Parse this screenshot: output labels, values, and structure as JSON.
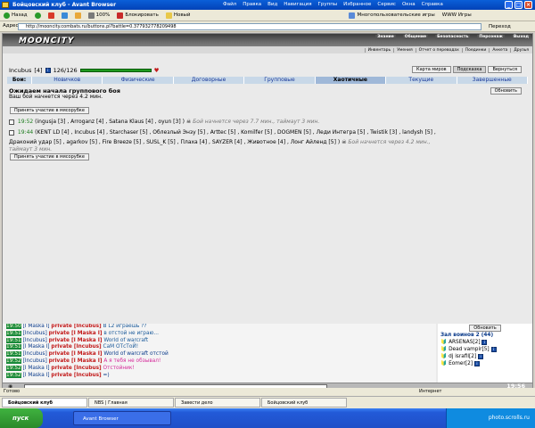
{
  "window": {
    "title": "Бойцовский клуб - Avant Browser"
  },
  "menu": [
    "Файл",
    "Правка",
    "Вид",
    "Навигация",
    "Группы",
    "Избранное",
    "Сервис",
    "Окна",
    "Справка"
  ],
  "toolbar": {
    "back": "Назад",
    "zoom": "100%",
    "block": "Блокировать",
    "new": "Новый",
    "multiuser": "Многопользовательские игры",
    "www": "WWW Игры"
  },
  "address": {
    "label": "Адрес",
    "url": "http://mooncity.combats.ru/buttons.pl?battle=0.377932778209498",
    "go": "Переход"
  },
  "site": {
    "logo": "MOONCITY",
    "topnav": [
      "Знание",
      "Общение",
      "Безопасность",
      "Персонаж",
      "Выход"
    ],
    "subnav": [
      "Инвентарь",
      "Умения",
      "Отчет о переводах",
      "Поединки",
      "Анкета",
      "Друзья"
    ]
  },
  "player": {
    "name": "Incubus",
    "level": "[4]",
    "hp": "126/126",
    "hp_fraction": 1.0
  },
  "right_buttons": [
    "Карта миров",
    "Подсказка",
    "Вернуться"
  ],
  "tabs": [
    {
      "label": "Бои:",
      "first": true
    },
    {
      "label": "Новичков"
    },
    {
      "label": "Физические"
    },
    {
      "label": "Договорные"
    },
    {
      "label": "Групповые"
    },
    {
      "label": "Хаотичные",
      "active": true
    },
    {
      "label": "Текущие"
    },
    {
      "label": "Завершенные"
    }
  ],
  "wait": {
    "title": "Ожидаем начала группового боя",
    "subtitle": "Ваш бой начнется через 4.2 мин.",
    "refresh": "Обновить",
    "join": "Принять участие в мясорубке"
  },
  "fights": [
    {
      "time": "19:52",
      "players": "(ingusja [3] , Arroganz [4] , Satana Klaus [4] , oyun [3] )",
      "note": "Бой начнется через 7.7 мин., таймаут 3 мин."
    },
    {
      "time": "19:44",
      "players": "(KENT LD [4] , Incubus [4] , Starchaser [5] , Облезлый Энзу [5] , Arttec [5] , Komilfer [5] , DOGMEN [5] , Леди Интегра [5] , Twistik [3] , landysh [5] ,",
      "players2": "Драконий удар [5] , agarkov [5] , Fire Breeze [5] , SUSL_K [5] , Плаха [4] , SAYZER [4] , Животное [4] , Лонг Айленд [5] )",
      "note": "Бой начнется через 4.2 мин.,",
      "note2": "таймаут 3 мин."
    }
  ],
  "chat": [
    {
      "time": "19:50",
      "from": "[I Maska I]",
      "pm": "private [Incubus]",
      "msg": "В L2 играешь ??",
      "cls": "mg"
    },
    {
      "time": "19:51",
      "from": "[Incubus]",
      "pm": "private [I Maska I]",
      "msg": "в отстой не играю...",
      "cls": "mg"
    },
    {
      "time": "19:51",
      "from": "[Incubus]",
      "pm": "private [I Maska I]",
      "msg": "World of warcraft",
      "cls": "mg"
    },
    {
      "time": "19:51",
      "from": "[I Maska I]",
      "pm": "private [Incubus]",
      "msg": "СаМ ОТсТоЙ!",
      "cls": "mg"
    },
    {
      "time": "19:51",
      "from": "[Incubus]",
      "pm": "private [I Maska I]",
      "msg": "World of warcraft отстой",
      "cls": "nm"
    },
    {
      "time": "19:52",
      "from": "[Incubus]",
      "pm": "private [I Maska I]",
      "msg": "А я тебя не обзывал!",
      "cls": "hl"
    },
    {
      "time": "19:52",
      "from": "[I Maska I]",
      "pm": "private [Incubus]",
      "msg": "Отстойник!",
      "cls": "hl"
    },
    {
      "time": "19:52",
      "from": "[I Maska I]",
      "pm": "private [Incubus]",
      "msg": "=)",
      "cls": "nm"
    }
  ],
  "online": {
    "refresh": "Обновить",
    "room": "Зал воинов 2 (44)",
    "users": [
      "ARSENAS[2]",
      "Dead vampir[5]",
      "dj israfil[2]",
      "Eomer[2]"
    ]
  },
  "clock": "19:56",
  "status": {
    "left": "Готово",
    "zone": "Интернет"
  },
  "browser_tabs": [
    {
      "label": "Бойцовский клуб",
      "active": true
    },
    {
      "label": "NBS | Главная"
    },
    {
      "label": "Завести дело"
    },
    {
      "label": "Бойцовский клуб"
    }
  ],
  "taskbar": {
    "start": "пуск",
    "item": "Avant Browser",
    "tray": "photo.scrolls.ru"
  }
}
